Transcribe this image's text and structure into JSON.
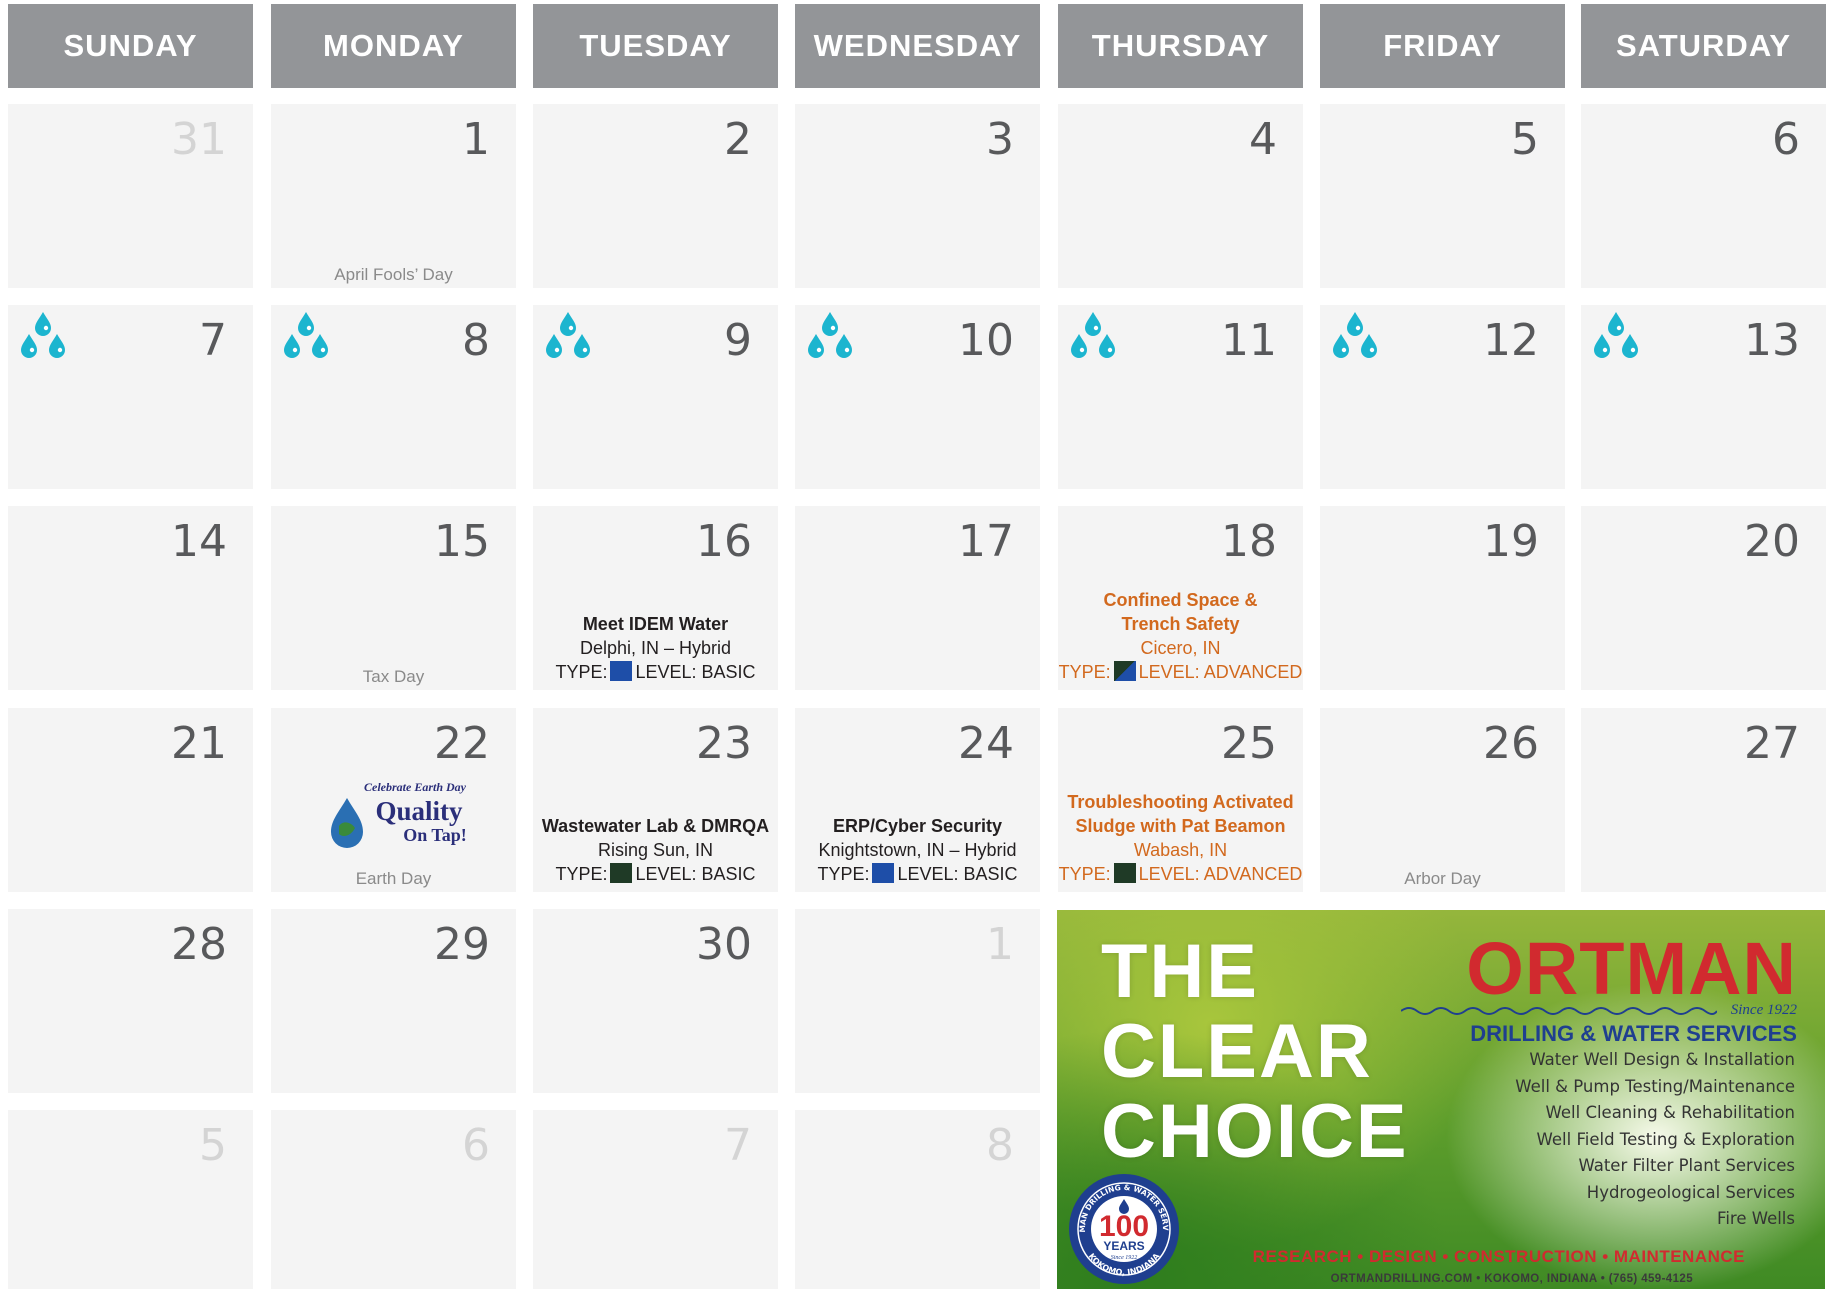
{
  "days": [
    "SUNDAY",
    "MONDAY",
    "TUESDAY",
    "WEDNESDAY",
    "THURSDAY",
    "FRIDAY",
    "SATURDAY"
  ],
  "weeks": [
    [
      {
        "n": "31",
        "dim": true
      },
      {
        "n": "1",
        "holiday": "April Fools’ Day"
      },
      {
        "n": "2"
      },
      {
        "n": "3"
      },
      {
        "n": "4"
      },
      {
        "n": "5"
      },
      {
        "n": "6"
      }
    ],
    [
      {
        "n": "7",
        "drops": true
      },
      {
        "n": "8",
        "drops": true
      },
      {
        "n": "9",
        "drops": true
      },
      {
        "n": "10",
        "drops": true
      },
      {
        "n": "11",
        "drops": true
      },
      {
        "n": "12",
        "drops": true
      },
      {
        "n": "13",
        "drops": true
      }
    ],
    [
      {
        "n": "14"
      },
      {
        "n": "15",
        "holiday": "Tax Day"
      },
      {
        "n": "16",
        "event": {
          "title": "Meet IDEM Water",
          "lines": [
            "Delphi, IN – Hybrid"
          ],
          "type_label": "TYPE:",
          "type_color": "blue",
          "level_label": "LEVEL: BASIC",
          "color": "black"
        }
      },
      {
        "n": "17"
      },
      {
        "n": "18",
        "event": {
          "title": "Confined Space &",
          "title2": "Trench Safety",
          "lines": [
            "Cicero, IN"
          ],
          "type_label": "TYPE:",
          "type_color": "split",
          "level_label": "LEVEL: ADVANCED",
          "color": "orange"
        }
      },
      {
        "n": "19"
      },
      {
        "n": "20"
      }
    ],
    [
      {
        "n": "21"
      },
      {
        "n": "22",
        "holiday": "Earth Day",
        "logo": {
          "line1": "Celebrate Earth Day",
          "line2": "Quality",
          "line3": "On Tap!"
        }
      },
      {
        "n": "23",
        "event": {
          "title": "Wastewater Lab & DMRQA",
          "lines": [
            "Rising Sun, IN"
          ],
          "type_label": "TYPE:",
          "type_color": "green",
          "level_label": "LEVEL: BASIC",
          "color": "black"
        }
      },
      {
        "n": "24",
        "event": {
          "title": "ERP/Cyber Security",
          "lines": [
            "Knightstown, IN – Hybrid"
          ],
          "type_label": "TYPE:",
          "type_color": "blue",
          "level_label": "LEVEL: BASIC",
          "color": "black"
        }
      },
      {
        "n": "25",
        "event": {
          "title": "Troubleshooting Activated",
          "title2": "Sludge with Pat Beamon",
          "lines": [
            "Wabash, IN"
          ],
          "type_label": "TYPE:",
          "type_color": "green",
          "level_label": "LEVEL: ADVANCED",
          "color": "orange"
        }
      },
      {
        "n": "26",
        "holiday": "Arbor Day"
      },
      {
        "n": "27"
      }
    ],
    [
      {
        "n": "28"
      },
      {
        "n": "29"
      },
      {
        "n": "30"
      },
      {
        "n": "1",
        "dim": true
      }
    ],
    [
      {
        "n": "5",
        "dim": true
      },
      {
        "n": "6",
        "dim": true
      },
      {
        "n": "7",
        "dim": true
      },
      {
        "n": "8",
        "dim": true
      }
    ]
  ],
  "ad": {
    "headline": [
      "THE",
      "CLEAR",
      "CHOICE"
    ],
    "brand": "ORTMAN",
    "since": "Since 1922",
    "subtitle": "DRILLING & WATER SERVICES",
    "services": [
      "Water Well Design & Installation",
      "Well & Pump Testing/Maintenance",
      "Well Cleaning & Rehabilitation",
      "Well Field Testing & Exploration",
      "Water Filter Plant Services",
      "Hydrogeological Services",
      "Fire Wells"
    ],
    "tagline": "RESEARCH  •  DESIGN  •  CONSTRUCTION  •  MAINTENANCE",
    "contact": "ORTMANDRILLING.COM  •  KOKOMO, INDIANA  •  (765) 459-4125",
    "badge": {
      "ring_top": "ORTMAN DRILLING & WATER SERVICES",
      "ring_bottom": "KOKOMO, INDIANA",
      "big": "100",
      "word": "YEARS",
      "since": "Since 1922"
    }
  },
  "colors": {
    "header_bg": "#939598",
    "cell_bg": "#f4f4f4",
    "drop": "#1cb5cf",
    "orange": "#d2691e",
    "type_blue": "#1e4ea8",
    "type_green": "#1f3a26",
    "brand_red": "#d12a2f",
    "brand_blue": "#1f3f8f"
  }
}
